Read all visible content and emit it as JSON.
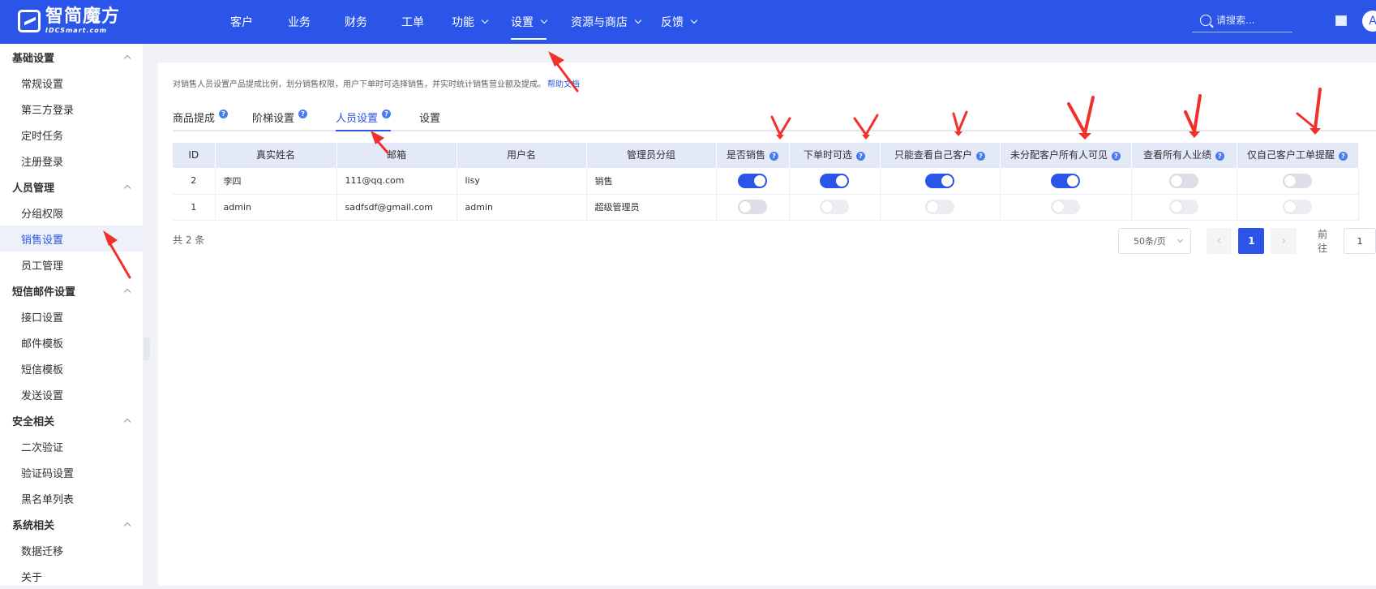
{
  "brand": {
    "name_cn": "智简魔方",
    "name_en": "IDCSmart.com"
  },
  "nav": [
    {
      "label": "客户",
      "dropdown": false
    },
    {
      "label": "业务",
      "dropdown": false
    },
    {
      "label": "财务",
      "dropdown": false
    },
    {
      "label": "工单",
      "dropdown": false
    },
    {
      "label": "功能",
      "dropdown": true
    },
    {
      "label": "设置",
      "dropdown": true,
      "active": true
    },
    {
      "label": "资源与商店",
      "dropdown": true
    },
    {
      "label": "反馈",
      "dropdown": true
    }
  ],
  "search": {
    "placeholder": "请搜索..."
  },
  "user": {
    "avatar_text": "A"
  },
  "sidebar": {
    "groups": [
      {
        "title": "基础设置",
        "items": [
          "常规设置",
          "第三方登录",
          "定时任务",
          "注册登录"
        ]
      },
      {
        "title": "人员管理",
        "items": [
          "分组权限",
          "销售设置",
          "员工管理"
        ]
      },
      {
        "title": "短信邮件设置",
        "items": [
          "接口设置",
          "邮件模板",
          "短信模板",
          "发送设置"
        ]
      },
      {
        "title": "安全相关",
        "items": [
          "二次验证",
          "验证码设置",
          "黑名单列表"
        ]
      },
      {
        "title": "系统相关",
        "items": [
          "数据迁移",
          "关于"
        ]
      }
    ],
    "active_item": "销售设置"
  },
  "page": {
    "description": "对销售人员设置产品提成比例，划分销售权限，用户下单时可选择销售，并实时统计销售营业额及提成。",
    "help_link": "帮助文档",
    "tabs": [
      {
        "label": "商品提成",
        "help": true
      },
      {
        "label": "阶梯设置",
        "help": true
      },
      {
        "label": "人员设置",
        "help": true,
        "active": true
      },
      {
        "label": "设置",
        "help": false
      }
    ]
  },
  "table": {
    "columns": [
      {
        "label": "ID",
        "help": false
      },
      {
        "label": "真实姓名",
        "help": false
      },
      {
        "label": "邮箱",
        "help": false
      },
      {
        "label": "用户名",
        "help": false
      },
      {
        "label": "管理员分组",
        "help": false
      },
      {
        "label": "是否销售",
        "help": true
      },
      {
        "label": "下单时可选",
        "help": true
      },
      {
        "label": "只能查看自己客户",
        "help": true
      },
      {
        "label": "未分配客户所有人可见",
        "help": true
      },
      {
        "label": "查看所有人业绩",
        "help": true
      },
      {
        "label": "仅自己客户工单提醒",
        "help": true
      }
    ],
    "rows": [
      {
        "id": "2",
        "name": "李四",
        "email": "111@qq.com",
        "username": "lisy",
        "group": "销售",
        "toggles": [
          "on",
          "on",
          "on",
          "on",
          "off",
          "off"
        ]
      },
      {
        "id": "1",
        "name": "admin",
        "email": "sadfsdf@gmail.com",
        "username": "admin",
        "group": "超级管理员",
        "toggles": [
          "off",
          "disabled",
          "disabled",
          "disabled",
          "disabled",
          "disabled"
        ]
      }
    ]
  },
  "pagination": {
    "total_text": "共 2 条",
    "page_size": "50条/页",
    "prev": "‹",
    "next": "›",
    "current_page": "1",
    "goto_label": "前往",
    "goto_value": "1"
  },
  "colors": {
    "primary": "#2b55e8",
    "annotation_arrow": "#f0312b"
  }
}
